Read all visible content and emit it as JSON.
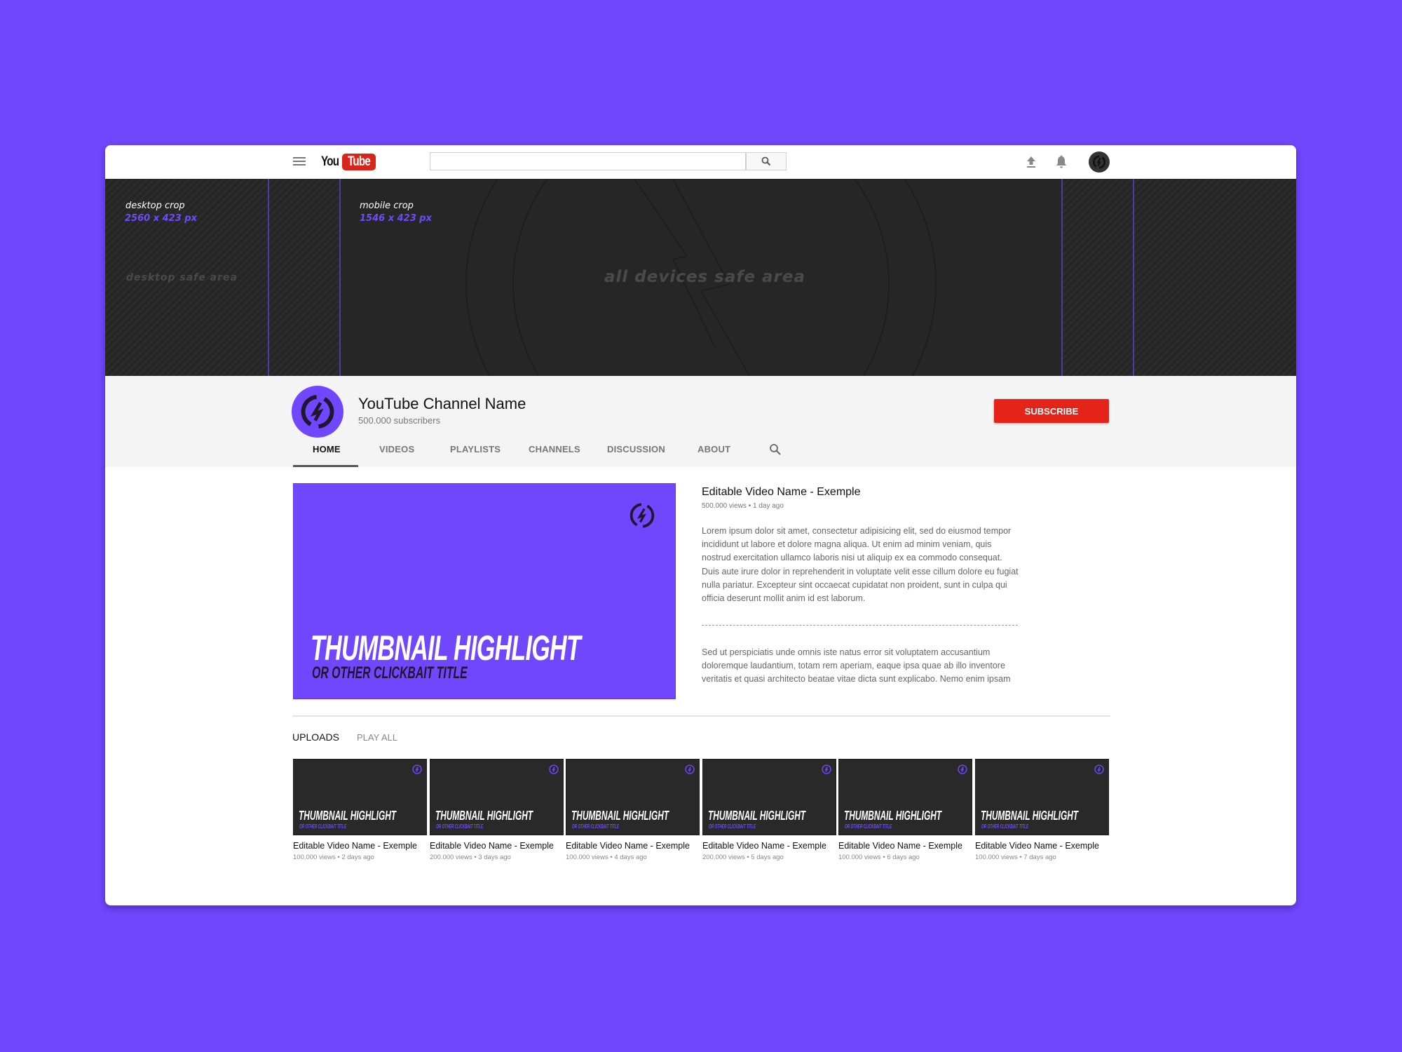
{
  "colors": {
    "background": "#7147fe",
    "accent": "#7147fe",
    "banner": "#262626",
    "subscribe": "#e52318",
    "youtube_red": "#d9241b"
  },
  "topbar": {
    "menu_icon": "hamburger-icon",
    "logo": {
      "you": "You",
      "tube": "Tube"
    },
    "search": {
      "value": "",
      "placeholder": ""
    },
    "search_icon": "search-icon",
    "upload_icon": "upload-icon",
    "notifications_icon": "bell-icon",
    "account_icon": "account-avatar"
  },
  "banner": {
    "desktop_crop_label": "desktop crop",
    "desktop_crop_size": "2560 x 423 px",
    "mobile_crop_label": "mobile crop",
    "mobile_crop_size": "1546 x 423 px",
    "desktop_safe_label": "desktop safe area",
    "all_devices_safe_label": "all devices safe area"
  },
  "channel": {
    "name": "YouTube Channel Name",
    "subscribers": "500.000 subscribers",
    "subscribe_label": "SUBSCRIBE",
    "tabs": [
      {
        "label": "HOME",
        "active": true
      },
      {
        "label": "VIDEOS",
        "active": false
      },
      {
        "label": "PLAYLISTS",
        "active": false
      },
      {
        "label": "CHANNELS",
        "active": false
      },
      {
        "label": "DISCUSSION",
        "active": false
      },
      {
        "label": "ABOUT",
        "active": false
      }
    ],
    "tab_search_icon": "search-icon"
  },
  "featured": {
    "thumbnail": {
      "headline": "THUMBNAIL HIGHLIGHT",
      "subline": "OR OTHER CLICKBAIT TITLE"
    },
    "title": "Editable Video Name - Exemple",
    "meta": "500.000 views • 1 day ago",
    "description_1": [
      "Lorem ipsum dolor sit amet, consectetur adipisicing elit, sed do eiusmod tempor",
      "incididunt ut labore et dolore magna aliqua. Ut enim ad minim veniam, quis",
      "nostrud exercitation ullamco laboris nisi ut aliquip ex ea commodo consequat.",
      "Duis aute irure dolor in reprehenderit in voluptate velit esse cillum dolore eu fugiat",
      "nulla pariatur. Excepteur sint occaecat cupidatat non proident, sunt in culpa qui",
      "officia deserunt mollit anim id est laborum."
    ],
    "description_2": [
      "Sed ut perspiciatis unde omnis iste natus error sit voluptatem accusantium",
      "doloremque laudantium, totam rem aperiam, eaque ipsa quae ab illo inventore",
      "veritatis et quasi architecto beatae vitae dicta sunt explicabo. Nemo enim ipsam"
    ]
  },
  "uploads": {
    "heading": "UPLOADS",
    "play_all": "PLAY ALL",
    "videos": [
      {
        "thumb_headline": "THUMBNAIL HIGHLIGHT",
        "thumb_subline": "OR OTHER CLICKBAIT TITLE",
        "title": "Editable Video Name - Exemple",
        "meta": "100.000 views • 2 days ago"
      },
      {
        "thumb_headline": "THUMBNAIL HIGHLIGHT",
        "thumb_subline": "OR OTHER CLICKBAIT TITLE",
        "title": "Editable Video Name - Exemple",
        "meta": "200.000 views • 3 days ago"
      },
      {
        "thumb_headline": "THUMBNAIL HIGHLIGHT",
        "thumb_subline": "OR OTHER CLICKBAIT TITLE",
        "title": "Editable Video Name - Exemple",
        "meta": "100.000 views • 4 days ago"
      },
      {
        "thumb_headline": "THUMBNAIL HIGHLIGHT",
        "thumb_subline": "OR OTHER CLICKBAIT TITLE",
        "title": "Editable Video Name - Exemple",
        "meta": "200.000 views • 5 days ago"
      },
      {
        "thumb_headline": "THUMBNAIL HIGHLIGHT",
        "thumb_subline": "OR OTHER CLICKBAIT TITLE",
        "title": "Editable Video Name - Exemple",
        "meta": "100.000 views • 6 days ago"
      },
      {
        "thumb_headline": "THUMBNAIL HIGHLIGHT",
        "thumb_subline": "OR OTHER CLICKBAIT TITLE",
        "title": "Editable Video Name - Exemple",
        "meta": "100.000 views • 7 days ago"
      }
    ]
  }
}
